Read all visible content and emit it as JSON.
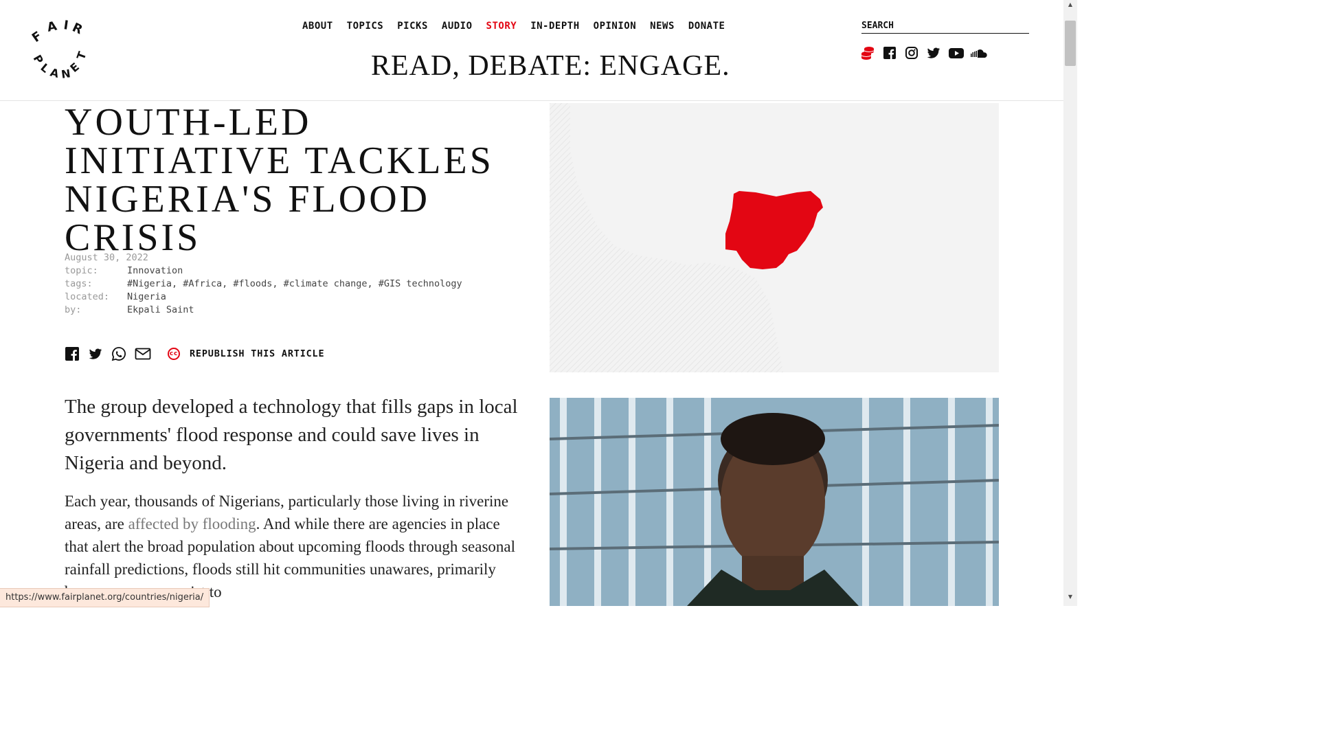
{
  "brand": {
    "logo_word_top": "FAIR",
    "logo_word_bottom": "PLANET",
    "accent_color": "#e30613"
  },
  "nav": {
    "items": [
      {
        "label": "ABOUT"
      },
      {
        "label": "TOPICS"
      },
      {
        "label": "PICKS"
      },
      {
        "label": "AUDIO"
      },
      {
        "label": "STORY",
        "active": true
      },
      {
        "label": "IN-DEPTH"
      },
      {
        "label": "OPINION"
      },
      {
        "label": "NEWS"
      },
      {
        "label": "DONATE"
      }
    ]
  },
  "tagline": "READ, DEBATE: ENGAGE.",
  "search": {
    "placeholder": "SEARCH"
  },
  "social_icons": [
    "coins-icon",
    "facebook-icon",
    "instagram-icon",
    "twitter-icon",
    "youtube-icon",
    "soundcloud-icon"
  ],
  "article": {
    "title": "YOUTH-LED INITIATIVE TACKLES NIGERIA'S FLOOD CRISIS",
    "date": "August 30, 2022",
    "meta": [
      {
        "key": "topic:",
        "value": "Innovation"
      },
      {
        "key": "tags:",
        "value": "#Nigeria, #Africa, #floods, #climate change, #GIS technology"
      },
      {
        "key": "located:",
        "value": "Nigeria"
      },
      {
        "key": "by:",
        "value": "Ekpali Saint"
      }
    ],
    "share_icons": [
      "facebook-icon",
      "twitter-icon",
      "whatsapp-icon",
      "mail-icon"
    ],
    "republish_label": "REPUBLISH THIS ARTICLE",
    "cc_badge": "cc",
    "lead": "The group developed a technology that fills gaps in local governments' flood response and could save lives in Nigeria and beyond.",
    "body_before_link": "Each year, thousands of Nigerians, particularly those living in riverine areas, are ",
    "body_link": "affected by flooding",
    "body_after_link": ". And while there are agencies in place that alert the broad population about upcoming floods through seasonal rainfall predictions, floods still hit communities unawares, primarily because no maps exist to"
  },
  "status_url": "https://www.fairplanet.org/countries/nigeria/"
}
